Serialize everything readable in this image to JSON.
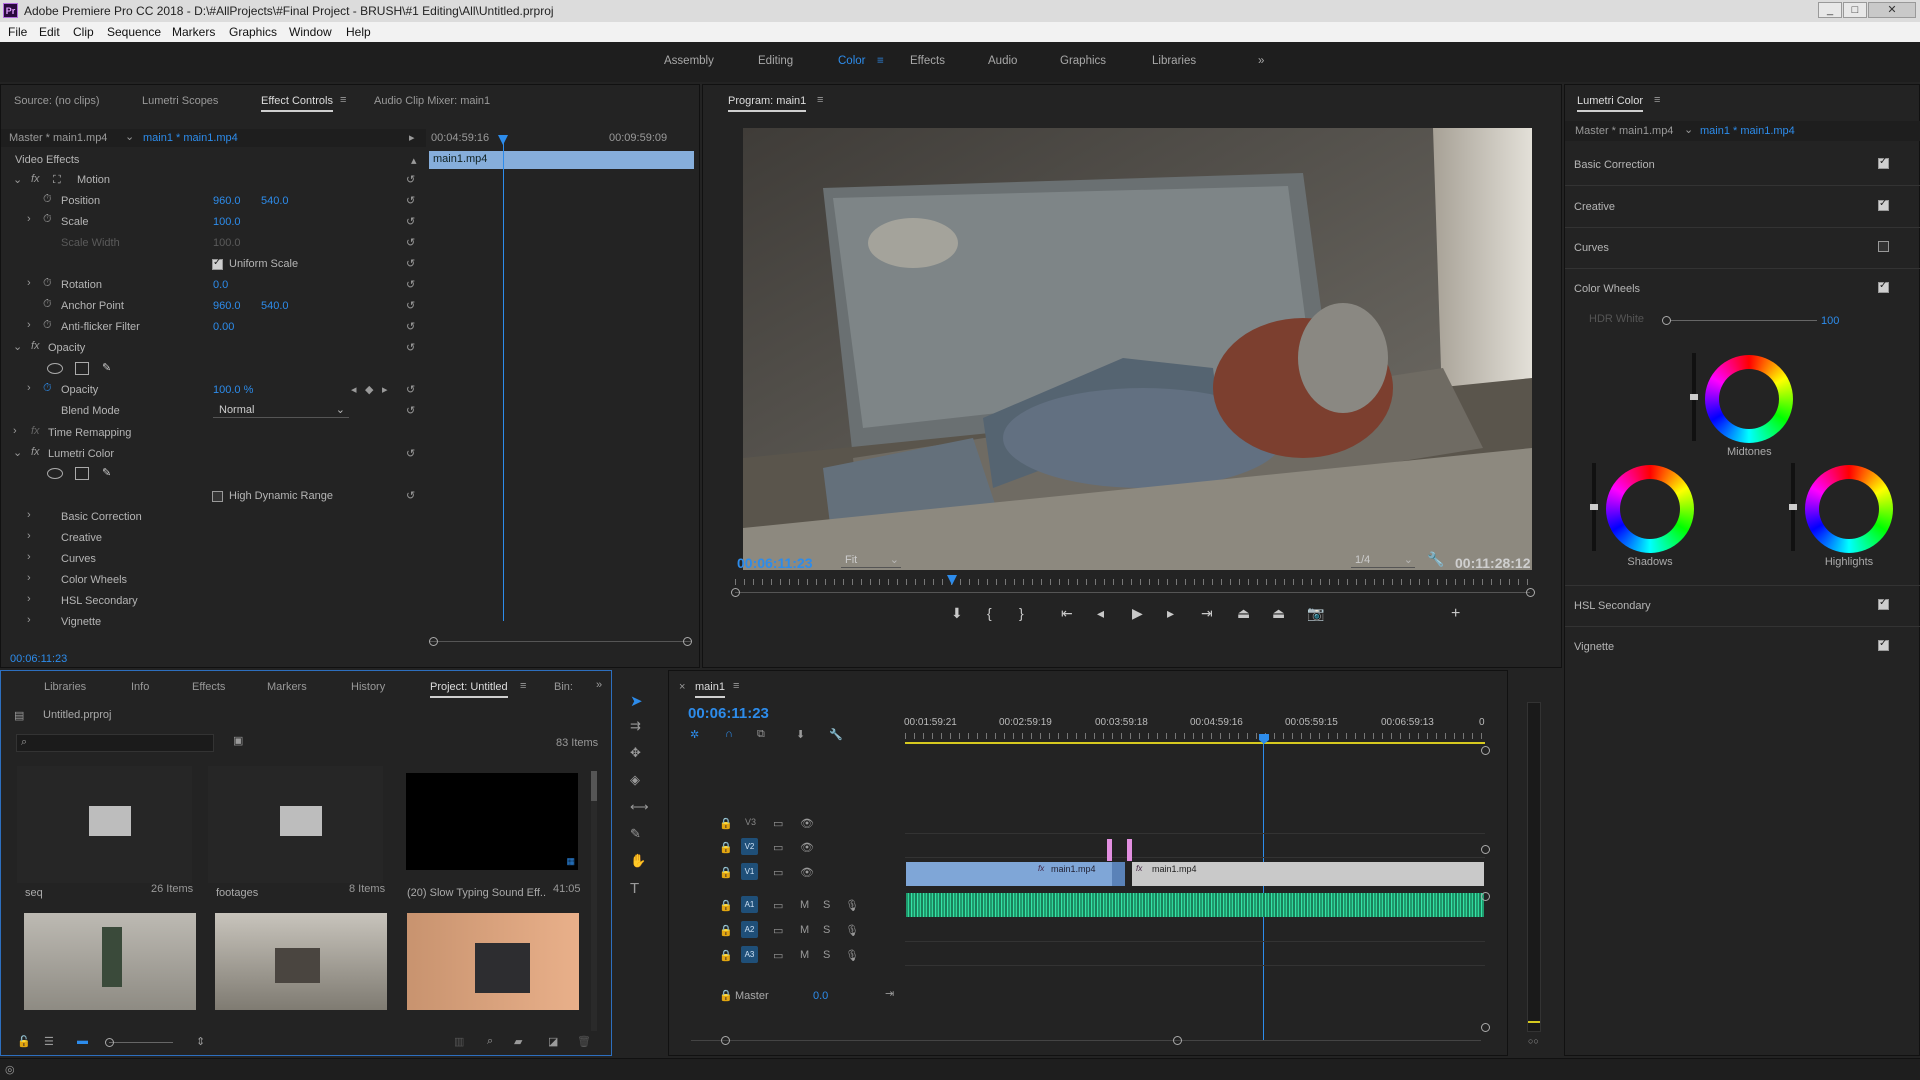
{
  "app": {
    "title": "Adobe Premiere Pro CC 2018 - D:\\#AllProjects\\#Final Project - BRUSH\\#1 Editing\\All\\Untitled.prproj",
    "logo": "Pr"
  },
  "menu": [
    "File",
    "Edit",
    "Clip",
    "Sequence",
    "Markers",
    "Graphics",
    "Window",
    "Help"
  ],
  "workspaces": [
    "Assembly",
    "Editing",
    "Color",
    "Effects",
    "Audio",
    "Graphics",
    "Libraries"
  ],
  "active_workspace": "Color",
  "source_panel": {
    "tabs": [
      "Source: (no clips)",
      "Lumetri Scopes",
      "Effect Controls",
      "Audio Clip Mixer: main1"
    ],
    "active": "Effect Controls",
    "master": "Master * main1.mp4",
    "clip": "main1 * main1.mp4",
    "time_start": "00:04:59:16",
    "time_end": "00:09:59:09",
    "clip_bar": "main1.mp4",
    "video_effects": "Video Effects",
    "timecode": "00:06:11:23",
    "rows": [
      {
        "label": "Motion"
      },
      {
        "label": "Position",
        "v1": "960.0",
        "v2": "540.0"
      },
      {
        "label": "Scale",
        "v1": "100.0"
      },
      {
        "label": "Scale Width",
        "v1": "100.0"
      },
      {
        "label": "Uniform Scale"
      },
      {
        "label": "Rotation",
        "v1": "0.0"
      },
      {
        "label": "Anchor Point",
        "v1": "960.0",
        "v2": "540.0"
      },
      {
        "label": "Anti-flicker Filter",
        "v1": "0.00"
      },
      {
        "label": "Opacity"
      },
      {
        "label": "Opacity",
        "v1": "100.0 %"
      },
      {
        "label": "Blend Mode",
        "v1": "Normal"
      },
      {
        "label": "Time Remapping"
      },
      {
        "label": "Lumetri Color"
      },
      {
        "label": "High Dynamic Range"
      },
      {
        "label": "Basic Correction"
      },
      {
        "label": "Creative"
      },
      {
        "label": "Curves"
      },
      {
        "label": "Color Wheels"
      },
      {
        "label": "HSL Secondary"
      },
      {
        "label": "Vignette"
      }
    ]
  },
  "program": {
    "title": "Program: main1",
    "timecode": "00:06:11:23",
    "fit": "Fit",
    "resolution": "1/4",
    "duration": "00:11:28:12"
  },
  "lumetri": {
    "title": "Lumetri Color",
    "master": "Master * main1.mp4",
    "clip": "main1 * main1.mp4",
    "sections": [
      {
        "label": "Basic Correction",
        "checked": true
      },
      {
        "label": "Creative",
        "checked": true
      },
      {
        "label": "Curves",
        "checked": false
      },
      {
        "label": "Color Wheels",
        "checked": true
      }
    ],
    "hdr_label": "HDR White",
    "hdr_value": "100",
    "wheels": [
      "Midtones",
      "Shadows",
      "Highlights"
    ],
    "bottom": [
      {
        "label": "HSL Secondary",
        "checked": true
      },
      {
        "label": "Vignette",
        "checked": true
      }
    ]
  },
  "project": {
    "tabs": [
      "Libraries",
      "Info",
      "Effects",
      "Markers",
      "History",
      "Project: Untitled",
      "Bin:"
    ],
    "active": "Project: Untitled",
    "file": "Untitled.prproj",
    "items_count": "83 Items",
    "bins": [
      {
        "name": "seq",
        "count": "26 Items"
      },
      {
        "name": "footages",
        "count": "8 Items"
      },
      {
        "name": "(20) Slow Typing Sound Eff...",
        "count": "41:05"
      }
    ]
  },
  "timeline": {
    "name": "main1",
    "timecode": "00:06:11:23",
    "ruler": [
      "00:01:59:21",
      "00:02:59:19",
      "00:03:59:18",
      "00:04:59:16",
      "00:05:59:15",
      "00:06:59:13",
      "0"
    ],
    "video_tracks": [
      "V3",
      "V2",
      "V1"
    ],
    "audio_tracks": [
      "A1",
      "A2",
      "A3"
    ],
    "master_label": "Master",
    "master_value": "0.0",
    "clips": [
      "main1.mp4",
      "main1.mp4"
    ]
  }
}
